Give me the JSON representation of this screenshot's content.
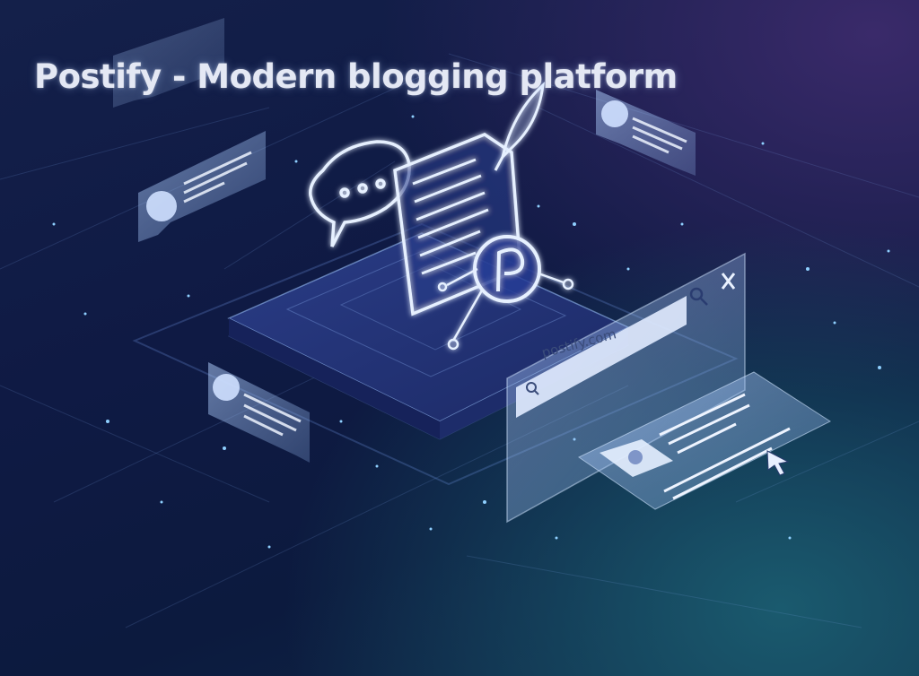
{
  "title": "Postify - Modern blogging platform",
  "browser": {
    "url": "postify.com"
  },
  "icons": [
    "speech-bubble-icon",
    "document-icon",
    "feather-quill-icon",
    "postify-p-logo-icon",
    "user-avatar-icon",
    "search-icon",
    "close-icon",
    "cursor-arrow-icon"
  ],
  "colors": {
    "background": "#101c46",
    "glow": "#bcd8ff",
    "panel": "#aac6f0"
  }
}
